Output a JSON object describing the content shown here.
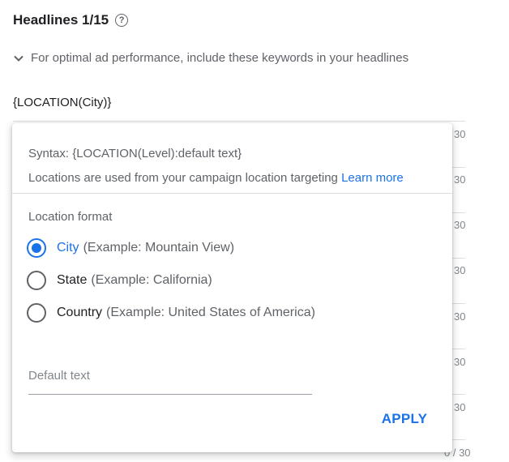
{
  "header": {
    "title": "Headlines 1/15",
    "help_icon": "?"
  },
  "keywords_hint": {
    "text": "For optimal ad performance, include these keywords in your headlines"
  },
  "headline_input": {
    "value": "{LOCATION(City)}"
  },
  "counters": [
    "30",
    "30",
    "30",
    "30",
    "30",
    "30",
    "30",
    "0 / 30"
  ],
  "popup": {
    "syntax": "Syntax: {LOCATION(Level):default text}",
    "location_note": "Locations are used from your campaign location targeting",
    "learn_more": "Learn more",
    "format_label": "Location format",
    "options": [
      {
        "name": "City",
        "example": "(Example: Mountain View)",
        "checked": true
      },
      {
        "name": "State",
        "example": "(Example: California)",
        "checked": false
      },
      {
        "name": "Country",
        "example": "(Example: United States of America)",
        "checked": false
      }
    ],
    "default_text_placeholder": "Default text",
    "apply_label": "APPLY"
  },
  "colors": {
    "accent": "#1a73e8",
    "secondary_text": "#5f6368",
    "divider": "#dadce0"
  }
}
